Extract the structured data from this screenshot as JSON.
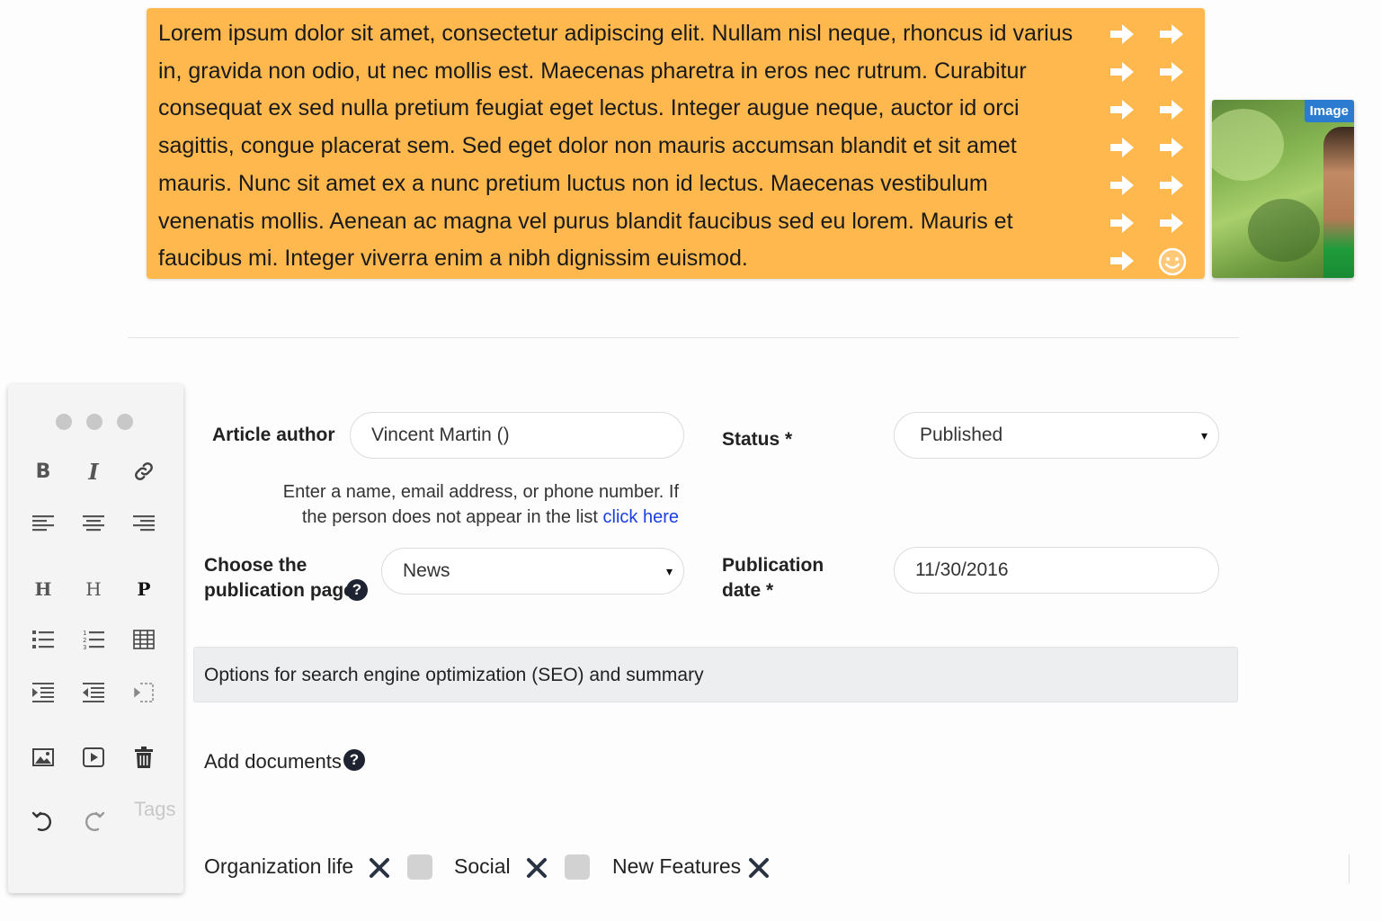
{
  "content_block": {
    "text": "Lorem ipsum dolor sit amet, consectetur adipiscing elit. Nullam nisl neque, rhoncus id varius in, gravida non odio, ut nec mollis est. Maecenas pharetra in eros nec rutrum. Curabitur consequat ex sed nulla pretium feugiat eget lectus. Integer augue neque, auctor id orci sagittis, congue placerat sem. Sed eget dolor non mauris accumsan blandit et sit amet mauris. Nunc sit amet ex a nunc pretium luctus non id lectus. Maecenas vestibulum venenatis mollis. Aenean ac magna vel purus blandit faucibus sed eu lorem. Mauris et faucibus mi. Integer viverra enim a nibh dignissim euismod.",
    "background_color": "#ffb84d",
    "icon": "arrow-right-icon",
    "end_icon": "smiley-icon"
  },
  "image_widget": {
    "badge": "Image",
    "badge_color": "#2b7bd0"
  },
  "toolbar": {
    "buttons": [
      "bold-icon",
      "italic-icon",
      "link-icon",
      "align-left-icon",
      "align-center-icon",
      "align-right-icon",
      "heading1-icon",
      "heading2-icon",
      "paragraph-icon",
      "bullet-list-icon",
      "numbered-list-icon",
      "table-icon",
      "indent-icon",
      "outdent-icon",
      "page-break-icon",
      "image-icon",
      "video-icon",
      "trash-icon",
      "undo-icon",
      "redo-icon"
    ],
    "heading1": "H",
    "heading2": "H",
    "paragraph": "P",
    "tags_label": "Tags"
  },
  "form": {
    "author_label": "Article author",
    "author_value": "Vincent Martin ()",
    "author_help": "Enter a name, email address, or phone number. If the person does not appear in the list",
    "author_help_link": "click here",
    "status_label": "Status *",
    "status_value": "Published",
    "page_label_line1": "Choose the",
    "page_label_line2": "publication page",
    "page_value": "News",
    "date_label_line1": "Publication",
    "date_label_line2": "date *",
    "date_value": "11/30/2016",
    "seo_label": "Options for search engine optimization (SEO) and summary",
    "documents_label": "Add documents",
    "select_arrow": "▾",
    "help_icon": "?"
  },
  "tags": [
    {
      "label": "Organization life"
    },
    {
      "label": "Social"
    },
    {
      "label": "New Features"
    }
  ]
}
